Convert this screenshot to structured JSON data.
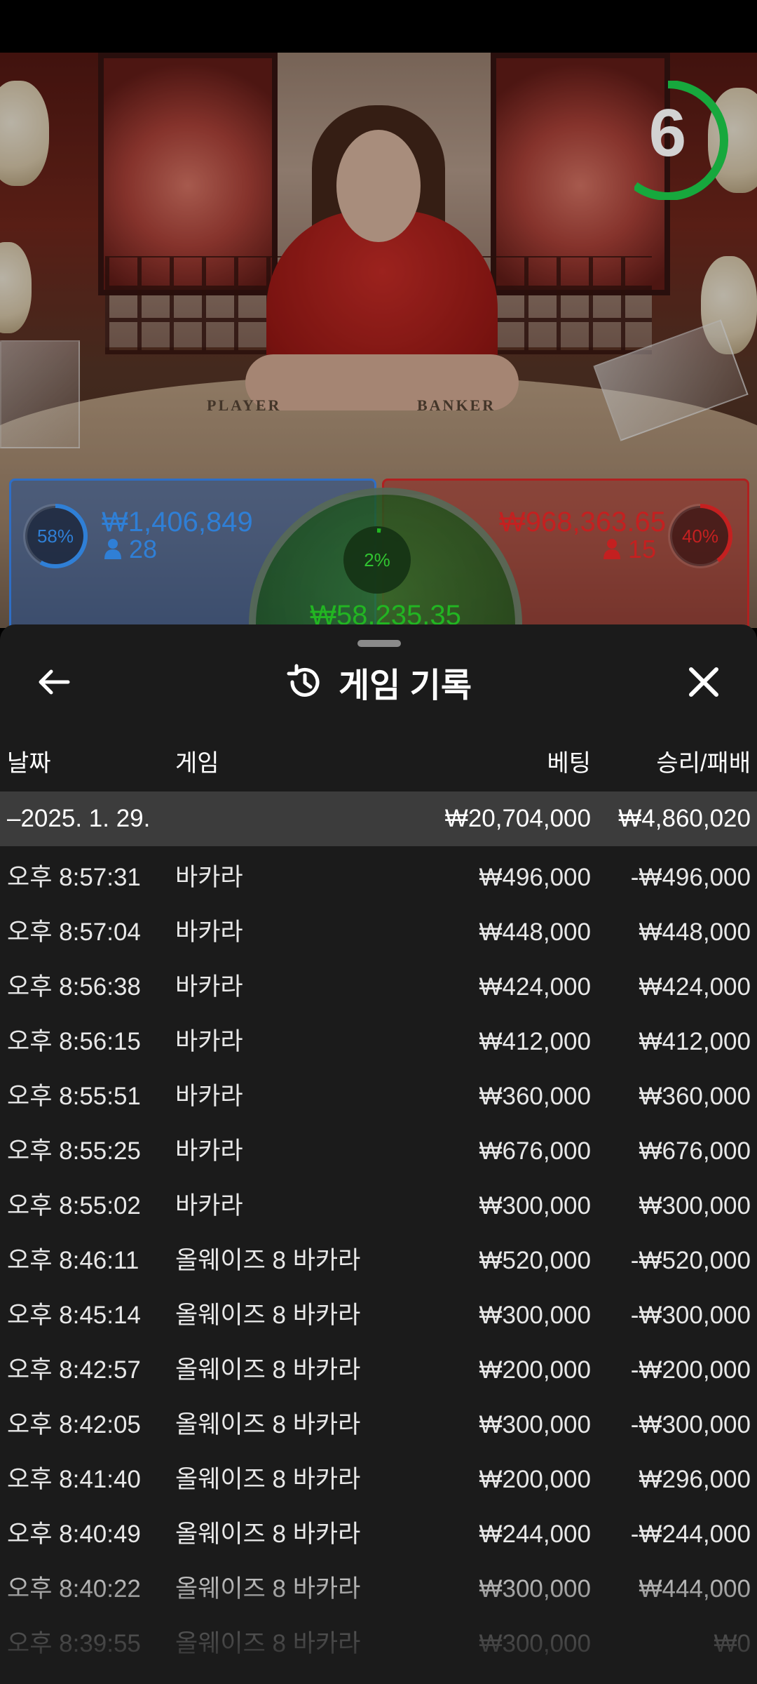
{
  "video": {
    "table_player_label": "PLAYER",
    "table_banker_label": "BANKER",
    "countdown": "6",
    "countdown_fraction": 0.6
  },
  "bets": {
    "player": {
      "percent": "58%",
      "percent_value": 0.58,
      "amount": "₩1,406,849",
      "players": "28",
      "color": "#2f7fd6"
    },
    "banker": {
      "percent": "40%",
      "percent_value": 0.4,
      "amount": "₩968,363.65",
      "players": "15",
      "color": "#c42020"
    },
    "tie": {
      "percent": "2%",
      "percent_value": 0.02,
      "amount": "₩58,235.35",
      "color": "#22b522"
    }
  },
  "sheet": {
    "title": "게임 기록",
    "icons": {
      "back": "arrow-left-icon",
      "history": "history-icon",
      "close": "close-icon"
    },
    "columns": {
      "date": "날짜",
      "game": "게임",
      "bet": "베팅",
      "result": "승리/패배"
    },
    "summary": {
      "date": "–2025. 1. 29.",
      "bet": "₩20,704,000",
      "result": "₩4,860,020"
    },
    "rows": [
      {
        "time": "오후 8:57:31",
        "game": "바카라",
        "bet": "₩496,000",
        "result": "-₩496,000"
      },
      {
        "time": "오후 8:57:04",
        "game": "바카라",
        "bet": "₩448,000",
        "result": "₩448,000"
      },
      {
        "time": "오후 8:56:38",
        "game": "바카라",
        "bet": "₩424,000",
        "result": "₩424,000"
      },
      {
        "time": "오후 8:56:15",
        "game": "바카라",
        "bet": "₩412,000",
        "result": "₩412,000"
      },
      {
        "time": "오후 8:55:51",
        "game": "바카라",
        "bet": "₩360,000",
        "result": "₩360,000"
      },
      {
        "time": "오후 8:55:25",
        "game": "바카라",
        "bet": "₩676,000",
        "result": "₩676,000"
      },
      {
        "time": "오후 8:55:02",
        "game": "바카라",
        "bet": "₩300,000",
        "result": "₩300,000"
      },
      {
        "time": "오후 8:46:11",
        "game": "올웨이즈 8 바카라",
        "bet": "₩520,000",
        "result": "-₩520,000"
      },
      {
        "time": "오후 8:45:14",
        "game": "올웨이즈 8 바카라",
        "bet": "₩300,000",
        "result": "-₩300,000"
      },
      {
        "time": "오후 8:42:57",
        "game": "올웨이즈 8 바카라",
        "bet": "₩200,000",
        "result": "-₩200,000"
      },
      {
        "time": "오후 8:42:05",
        "game": "올웨이즈 8 바카라",
        "bet": "₩300,000",
        "result": "-₩300,000"
      },
      {
        "time": "오후 8:41:40",
        "game": "올웨이즈 8 바카라",
        "bet": "₩200,000",
        "result": "₩296,000"
      },
      {
        "time": "오후 8:40:49",
        "game": "올웨이즈 8 바카라",
        "bet": "₩244,000",
        "result": "-₩244,000"
      },
      {
        "time": "오후 8:40:22",
        "game": "올웨이즈 8 바카라",
        "bet": "₩300,000",
        "result": "₩444,000"
      },
      {
        "time": "오후 8:39:55",
        "game": "올웨이즈 8 바카라",
        "bet": "₩300,000",
        "result": "₩0"
      }
    ]
  }
}
